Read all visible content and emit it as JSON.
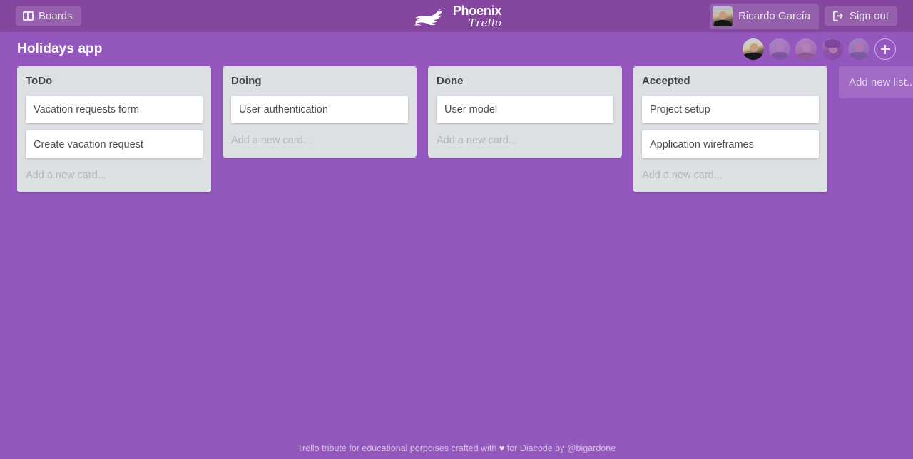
{
  "theme": {
    "background": "#9457be",
    "header_background": "#84469f",
    "list_background": "#dcdfe3",
    "card_background": "#ffffff",
    "text_on_purple": "#ffffff",
    "list_title_color": "#41464b",
    "card_text_color": "#4d4d4d",
    "placeholder_color": "#b3b7bb"
  },
  "header": {
    "boards_label": "Boards",
    "boards_icon": "board-columns-icon",
    "logo": {
      "bird_icon": "phoenix-bird-icon",
      "line1": "Phoenix",
      "line2": "Trello"
    },
    "user": {
      "name": "Ricardo García",
      "avatar_icon": "user-avatar"
    },
    "signout_label": "Sign out",
    "signout_icon": "sign-out-icon"
  },
  "board": {
    "title": "Holidays app",
    "members": [
      {
        "name": "member-1",
        "faded": false
      },
      {
        "name": "member-2",
        "faded": true
      },
      {
        "name": "member-3",
        "faded": true
      },
      {
        "name": "member-4",
        "faded": true
      },
      {
        "name": "member-5",
        "faded": true
      }
    ],
    "add_member_icon": "plus-icon",
    "lists": [
      {
        "title": "ToDo",
        "cards": [
          "Vacation requests form",
          "Create vacation request"
        ],
        "add_card_placeholder": "Add a new card..."
      },
      {
        "title": "Doing",
        "cards": [
          "User authentication"
        ],
        "add_card_placeholder": "Add a new card..."
      },
      {
        "title": "Done",
        "cards": [
          "User model"
        ],
        "add_card_placeholder": "Add a new card..."
      },
      {
        "title": "Accepted",
        "cards": [
          "Project setup",
          "Application wireframes"
        ],
        "add_card_placeholder": "Add a new card..."
      }
    ],
    "add_list_label": "Add new list..."
  },
  "footer": {
    "text_before": "Trello tribute for educational porpoises crafted with",
    "heart": "♥",
    "text_after": "for Diacode by @bigardone"
  }
}
